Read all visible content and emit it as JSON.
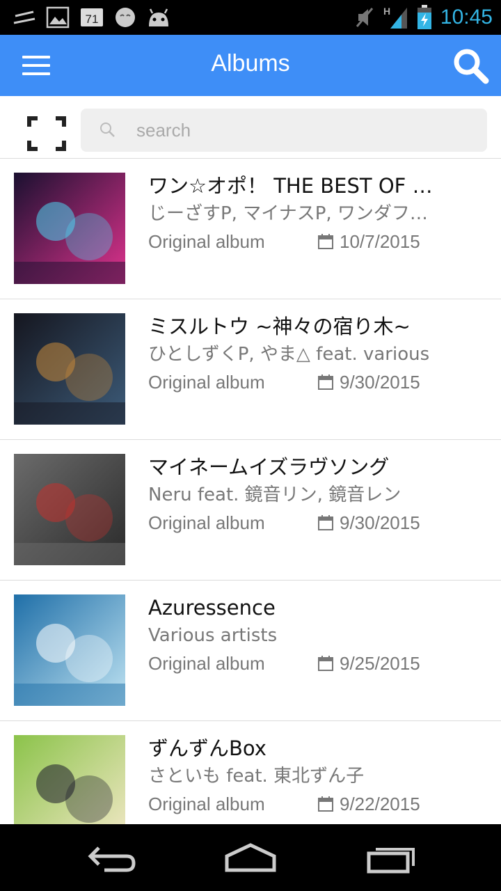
{
  "status_bar": {
    "time": "10:45",
    "notification_badge": "71",
    "network_type": "H",
    "icons": [
      "notification-lines-icon",
      "image-icon",
      "calendar-badge-icon",
      "face-icon",
      "android-icon",
      "mute-icon",
      "signal-icon",
      "battery-charging-icon"
    ],
    "time_color": "#33b5e5"
  },
  "app_bar": {
    "title": "Albums",
    "color": "#3e8ef7",
    "icons": [
      "menu-icon",
      "search-icon"
    ]
  },
  "search": {
    "placeholder": "search",
    "value": "",
    "icons": [
      "scan-frame-icon",
      "search-icon"
    ]
  },
  "albums": [
    {
      "name": "ワン☆オポ！ THE BEST OF BEST!",
      "artist": "じーざすP, マイナスP, ワンダフル☆オポチュニティ!",
      "type": "Original album",
      "date": "10/7/2015",
      "cover_colors": [
        "#1a1030",
        "#e0338e",
        "#4cd4f0"
      ]
    },
    {
      "name": "ミスルトウ ~神々の宿り木~",
      "artist": "ひとしずくP, やま△ feat. various",
      "type": "Original album",
      "date": "9/30/2015",
      "cover_colors": [
        "#15161f",
        "#3d5c7a",
        "#c98a3a"
      ]
    },
    {
      "name": "マイネームイズラヴソング",
      "artist": "Neru feat. 鏡音リン, 鏡音レン",
      "type": "Original album",
      "date": "9/30/2015",
      "cover_colors": [
        "#6b6b6b",
        "#2a2a2a",
        "#c4312d"
      ]
    },
    {
      "name": "Azuressence",
      "artist": "Various artists",
      "type": "Original album",
      "date": "9/25/2015",
      "cover_colors": [
        "#1f6fa8",
        "#bfe3f2",
        "#ffffff"
      ]
    },
    {
      "name": "ずんずんBox",
      "artist": "さといも feat. 東北ずん子",
      "type": "Original album",
      "date": "9/22/2015",
      "cover_colors": [
        "#8bc34a",
        "#f3e8c8",
        "#1a1a2a"
      ]
    }
  ],
  "nav_bar": {
    "icons": [
      "back-icon",
      "home-icon",
      "recents-icon"
    ]
  }
}
